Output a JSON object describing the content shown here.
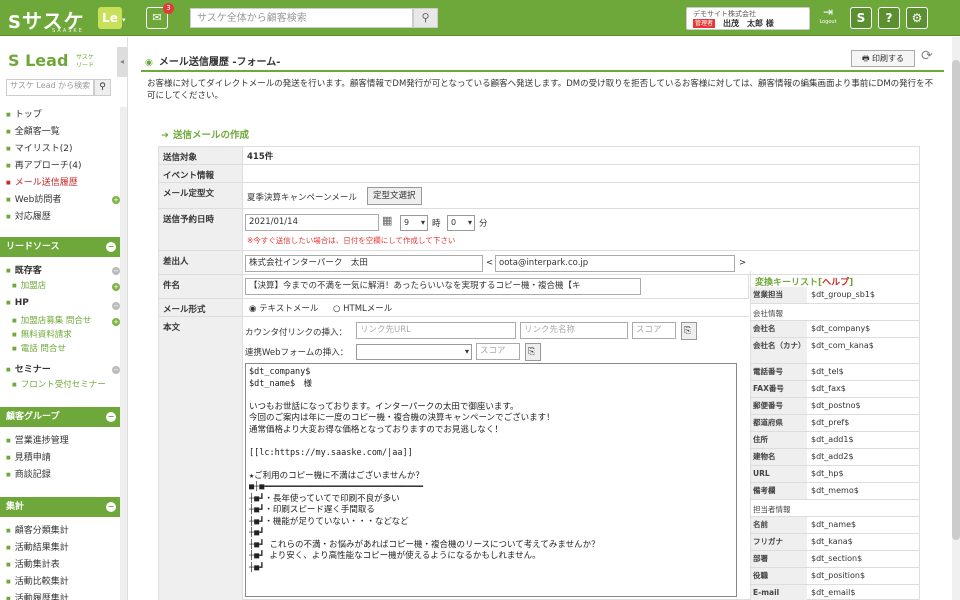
{
  "app": {
    "logo": "サスケ",
    "logo_sub": "SAASKE",
    "le": "Le",
    "msg_count": "3",
    "search_placeholder": "サスケ全体から顧客検索"
  },
  "user": {
    "company": "デモサイト株式会社",
    "role": "管理者",
    "name": "出茂　太郎 様",
    "logout": "Logout"
  },
  "toolbar_icons": [
    "S",
    "?",
    "⚙"
  ],
  "sidebar": {
    "logo": "Lead",
    "logo_sub": "サスケ\nリード",
    "search_placeholder": "サスケ Lead から検索",
    "items": [
      "トップ",
      "全顧客一覧",
      "マイリスト(2)",
      "再アプローチ(4)",
      "メール送信履歴",
      "Web訪問者",
      "対応履歴"
    ],
    "head1": "リードソース",
    "sub1": "既存客",
    "sub1_items": [
      "加盟店"
    ],
    "sub2": "HP",
    "sub2_items": [
      "加盟店募集 問合せ",
      "無料資料請求",
      "電話 問合せ"
    ],
    "sub3": "セミナー",
    "sub3_items": [
      "フロント受付セミナー"
    ],
    "head2": "顧客グループ",
    "group_items": [
      "営業進捗管理",
      "見積申請",
      "商談記録"
    ],
    "head3": "集計",
    "stat_items": [
      "顧客分類集計",
      "活動結果集計",
      "活動集計表",
      "活動比較集計",
      "活動履歴集計"
    ]
  },
  "page": {
    "title": "メール送信履歴 -フォーム-",
    "print": "印刷する",
    "description": "お客様に対してダイレクトメールの発送を行います。顧客情報でDM発行が可となっている顧客へ発送します。DMの受け取りを拒否しているお客様に対しては、顧客情報の編集画面より事前にDMの発行を不可にしてください。",
    "section": "送信メールの作成"
  },
  "form": {
    "target_label": "送信対象",
    "target_value": "415件",
    "event_label": "イベント情報",
    "template_label": "メール定型文",
    "template_value": "夏季決算キャンペーンメール",
    "template_btn": "定型文選択",
    "schedule_label": "送信予約日時",
    "date": "2021/01/14",
    "hour": "9",
    "hour_unit": "時",
    "minute": "0",
    "minute_unit": "分",
    "schedule_note": "※今すぐ送信したい場合は、日付を空欄にして作成して下さい",
    "sender_label": "差出人",
    "sender_name": "株式会社インターパーク　太田",
    "sender_lt": "<",
    "sender_email": "oota@interpark.co.jp",
    "sender_gt": ">",
    "subject_label": "件名",
    "subject": "【決算】今までの不満を一気に解消！あったらいいなを実現するコピー機・複合機【キ",
    "format_label": "メール形式",
    "format_text": "テキストメール",
    "format_html": "HTMLメール",
    "body_label": "本文",
    "link_label": "カウンタ付リンクの挿入：",
    "link_url_ph": "リンク先URL",
    "link_name_ph": "リンク先名称",
    "score_ph": "スコア",
    "webform_label": "連携Webフォームの挿入：",
    "webform_score_ph": "スコア",
    "body": "$dt_company$\n$dt_name$　様\n\nいつもお世話になっております。インターパークの太田で御座います。\n今回のご案内は年に一度のコピー機・複合機の決算キャンペーンでございます！\n通常価格より大変お得な価格となっておりますのでお見逃しなく！\n\n[[lc:https://my.saaske.com/|aa]]\n\n★ご利用のコピー機に不満はございませんか？\n■┼■━━━━━━━━━━━━━━━━━━━━━━━━━━━━━━━\n┼■┛・長年使っていてで印刷不良が多い\n┼■┛・印刷スピード遅く手間取る\n┼■┛・機能が足りていない・・・などなど\n┼■┛\n┼■┛ これらの不満・お悩みがあればコピー機・複合機のリースについて考えてみませんか？\n┼■┛ より安く、より高性能なコピー機が使えるようになるかもしれません。\n┼■┛"
  },
  "vars": {
    "title": "変換キーリスト",
    "help": "ヘルプ",
    "rows": [
      {
        "k": "営業担当",
        "v": "$dt_group_sb1$"
      },
      {
        "cat": "会社情報"
      },
      {
        "k": "会社名",
        "v": "$dt_company$"
      },
      {
        "k": "会社名（カナ）",
        "v": "$dt_com_kana$"
      },
      {
        "k": "電話番号",
        "v": "$dt_tel$"
      },
      {
        "k": "FAX番号",
        "v": "$dt_fax$"
      },
      {
        "k": "郵便番号",
        "v": "$dt_postno$"
      },
      {
        "k": "都道府県",
        "v": "$dt_pref$"
      },
      {
        "k": "住所",
        "v": "$dt_add1$"
      },
      {
        "k": "建物名",
        "v": "$dt_add2$"
      },
      {
        "k": "URL",
        "v": "$dt_hp$"
      },
      {
        "k": "備考欄",
        "v": "$dt_memo$"
      },
      {
        "cat": "担当者情報"
      },
      {
        "k": "名前",
        "v": "$dt_name$"
      },
      {
        "k": "フリガナ",
        "v": "$dt_kana$"
      },
      {
        "k": "部署",
        "v": "$dt_section$"
      },
      {
        "k": "役職",
        "v": "$dt_position$"
      },
      {
        "k": "E-mail",
        "v": "$dt_email$"
      }
    ]
  }
}
